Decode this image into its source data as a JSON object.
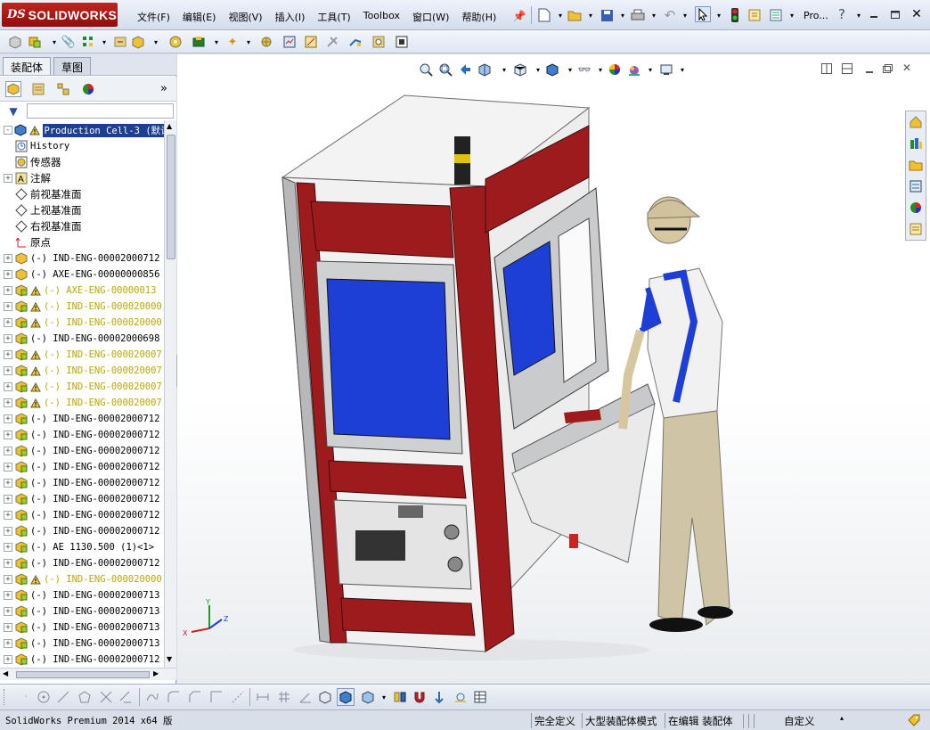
{
  "app": {
    "logo_prefix": "DS",
    "logo_name": "SOLIDWORKS",
    "doc_title": "Pro..."
  },
  "menu": [
    "文件(F)",
    "编辑(E)",
    "视图(V)",
    "插入(I)",
    "工具(T)",
    "Toolbox",
    "窗口(W)",
    "帮助(H)"
  ],
  "panel": {
    "tabs": [
      "装配体",
      "草图"
    ],
    "collapse_label": "»"
  },
  "tree": [
    {
      "label": "Production Cell-3  (默认",
      "icon": "assembly-icon",
      "expand": "-",
      "warn": true,
      "selected": true,
      "yellow": false,
      "cn": false
    },
    {
      "label": "History",
      "icon": "history-icon",
      "expand": "",
      "warn": false,
      "selected": false,
      "yellow": false,
      "cn": false
    },
    {
      "label": "传感器",
      "icon": "sensor-icon",
      "expand": "",
      "warn": false,
      "selected": false,
      "yellow": false,
      "cn": true
    },
    {
      "label": "注解",
      "icon": "annotation-icon",
      "expand": "+",
      "warn": false,
      "selected": false,
      "yellow": false,
      "cn": true
    },
    {
      "label": "前视基准面",
      "icon": "plane-icon",
      "expand": "",
      "warn": false,
      "selected": false,
      "yellow": false,
      "cn": true
    },
    {
      "label": "上视基准面",
      "icon": "plane-icon",
      "expand": "",
      "warn": false,
      "selected": false,
      "yellow": false,
      "cn": true
    },
    {
      "label": "右视基准面",
      "icon": "plane-icon",
      "expand": "",
      "warn": false,
      "selected": false,
      "yellow": false,
      "cn": true
    },
    {
      "label": "原点",
      "icon": "origin-icon",
      "expand": "",
      "warn": false,
      "selected": false,
      "yellow": false,
      "cn": true
    },
    {
      "label": "(-) IND-ENG-00002000712",
      "icon": "part-icon",
      "expand": "+",
      "warn": false,
      "selected": false,
      "yellow": false,
      "cn": false
    },
    {
      "label": "(-) AXE-ENG-00000000856",
      "icon": "part-icon",
      "expand": "+",
      "warn": false,
      "selected": false,
      "yellow": false,
      "cn": false
    },
    {
      "label": "(-) AXE-ENG-00000013",
      "icon": "subassembly-icon",
      "expand": "+",
      "warn": true,
      "selected": false,
      "yellow": true,
      "cn": false
    },
    {
      "label": "(-) IND-ENG-000020000",
      "icon": "subassembly-icon",
      "expand": "+",
      "warn": true,
      "selected": false,
      "yellow": true,
      "cn": false
    },
    {
      "label": "(-) IND-ENG-000020000",
      "icon": "subassembly-icon",
      "expand": "+",
      "warn": true,
      "selected": false,
      "yellow": true,
      "cn": false
    },
    {
      "label": "(-) IND-ENG-00002000698",
      "icon": "subassembly-icon",
      "expand": "+",
      "warn": false,
      "selected": false,
      "yellow": false,
      "cn": false
    },
    {
      "label": "(-) IND-ENG-000020007",
      "icon": "subassembly-icon",
      "expand": "+",
      "warn": true,
      "selected": false,
      "yellow": true,
      "cn": false
    },
    {
      "label": "(-) IND-ENG-000020007",
      "icon": "subassembly-icon",
      "expand": "+",
      "warn": true,
      "selected": false,
      "yellow": true,
      "cn": false
    },
    {
      "label": "(-) IND-ENG-000020007",
      "icon": "subassembly-icon",
      "expand": "+",
      "warn": true,
      "selected": false,
      "yellow": true,
      "cn": false
    },
    {
      "label": "(-) IND-ENG-000020007",
      "icon": "subassembly-icon",
      "expand": "+",
      "warn": true,
      "selected": false,
      "yellow": true,
      "cn": false
    },
    {
      "label": "(-) IND-ENG-00002000712",
      "icon": "subassembly-icon",
      "expand": "+",
      "warn": false,
      "selected": false,
      "yellow": false,
      "cn": false
    },
    {
      "label": "(-) IND-ENG-00002000712",
      "icon": "subassembly-icon",
      "expand": "+",
      "warn": false,
      "selected": false,
      "yellow": false,
      "cn": false
    },
    {
      "label": "(-) IND-ENG-00002000712",
      "icon": "subassembly-icon",
      "expand": "+",
      "warn": false,
      "selected": false,
      "yellow": false,
      "cn": false
    },
    {
      "label": "(-) IND-ENG-00002000712",
      "icon": "subassembly-icon",
      "expand": "+",
      "warn": false,
      "selected": false,
      "yellow": false,
      "cn": false
    },
    {
      "label": "(-) IND-ENG-00002000712",
      "icon": "subassembly-icon",
      "expand": "+",
      "warn": false,
      "selected": false,
      "yellow": false,
      "cn": false
    },
    {
      "label": "(-) IND-ENG-00002000712",
      "icon": "subassembly-icon",
      "expand": "+",
      "warn": false,
      "selected": false,
      "yellow": false,
      "cn": false
    },
    {
      "label": "(-) IND-ENG-00002000712",
      "icon": "subassembly-icon",
      "expand": "+",
      "warn": false,
      "selected": false,
      "yellow": false,
      "cn": false
    },
    {
      "label": "(-) IND-ENG-00002000712",
      "icon": "subassembly-icon",
      "expand": "+",
      "warn": false,
      "selected": false,
      "yellow": false,
      "cn": false
    },
    {
      "label": "(-) AE 1130.500  (1)<1>",
      "icon": "subassembly-icon",
      "expand": "+",
      "warn": false,
      "selected": false,
      "yellow": false,
      "cn": false
    },
    {
      "label": "(-) IND-ENG-00002000712",
      "icon": "subassembly-icon",
      "expand": "+",
      "warn": false,
      "selected": false,
      "yellow": false,
      "cn": false
    },
    {
      "label": "(-) IND-ENG-000020000",
      "icon": "subassembly-icon",
      "expand": "+",
      "warn": true,
      "selected": false,
      "yellow": true,
      "cn": false
    },
    {
      "label": "(-) IND-ENG-00002000713",
      "icon": "subassembly-icon",
      "expand": "+",
      "warn": false,
      "selected": false,
      "yellow": false,
      "cn": false
    },
    {
      "label": "(-) IND-ENG-00002000713",
      "icon": "subassembly-icon",
      "expand": "+",
      "warn": false,
      "selected": false,
      "yellow": false,
      "cn": false
    },
    {
      "label": "(-) IND-ENG-00002000713",
      "icon": "subassembly-icon",
      "expand": "+",
      "warn": false,
      "selected": false,
      "yellow": false,
      "cn": false
    },
    {
      "label": "(-) IND-ENG-00002000713",
      "icon": "subassembly-icon",
      "expand": "+",
      "warn": false,
      "selected": false,
      "yellow": false,
      "cn": false
    },
    {
      "label": "(-) IND-ENG-00002000712",
      "icon": "subassembly-icon",
      "expand": "+",
      "warn": false,
      "selected": false,
      "yellow": false,
      "cn": false
    }
  ],
  "triad": {
    "x": "X",
    "y": "Y",
    "z": "Z"
  },
  "status": {
    "version": "SolidWorks Premium 2014 x64 版",
    "definition": "完全定义",
    "mode": "大型装配体模式",
    "editing": "在编辑 装配体",
    "units": "自定义"
  },
  "colors": {
    "accent_red": "#9e1b1d",
    "screen_blue": "#1e3fd6",
    "selection_blue": "#1c3f91",
    "warning_yellow": "#b9a900"
  }
}
